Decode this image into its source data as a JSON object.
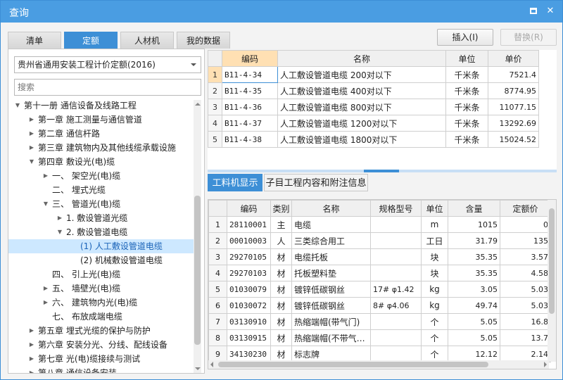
{
  "window": {
    "title": "查询"
  },
  "tabs": [
    {
      "label": "清单"
    },
    {
      "label": "定额"
    },
    {
      "label": "人材机"
    },
    {
      "label": "我的数据"
    }
  ],
  "active_tab": 1,
  "quota_select": {
    "value": "贵州省通用安装工程计价定额(2016)"
  },
  "search": {
    "placeholder": "搜索"
  },
  "tree": [
    {
      "label": "第十一册 通信设备及线路工程",
      "level": 0,
      "exp": "down"
    },
    {
      "label": "第一章 施工测量与通信管道",
      "level": 1,
      "exp": "right"
    },
    {
      "label": "第二章 通信杆路",
      "level": 1,
      "exp": "right"
    },
    {
      "label": "第三章 建筑物内及其他线缆承载设施",
      "level": 1,
      "exp": "right"
    },
    {
      "label": "第四章 敷设光(电)缆",
      "level": 1,
      "exp": "down"
    },
    {
      "label": "一、 架空光(电)缆",
      "level": 2,
      "exp": "right"
    },
    {
      "label": "二、 埋式光缆",
      "level": 2,
      "exp": ""
    },
    {
      "label": "三、 管道光(电)缆",
      "level": 2,
      "exp": "down"
    },
    {
      "label": "1. 敷设管道光缆",
      "level": 3,
      "exp": "right"
    },
    {
      "label": "2. 敷设管道电缆",
      "level": 3,
      "exp": "down"
    },
    {
      "label": "(1) 人工敷设管道电缆",
      "level": 4,
      "exp": "",
      "selected": true
    },
    {
      "label": "(2) 机械敷设管道电缆",
      "level": 4,
      "exp": ""
    },
    {
      "label": "四、 引上光(电)缆",
      "level": 2,
      "exp": ""
    },
    {
      "label": "五、 墙壁光(电)缆",
      "level": 2,
      "exp": "right"
    },
    {
      "label": "六、 建筑物内光(电)缆",
      "level": 2,
      "exp": "right"
    },
    {
      "label": "七、 布放成端电缆",
      "level": 2,
      "exp": ""
    },
    {
      "label": "第五章 埋式光缆的保护与防护",
      "level": 1,
      "exp": "right"
    },
    {
      "label": "第六章 安装分光、分线、配线设备",
      "level": 1,
      "exp": "right"
    },
    {
      "label": "第七章 光(电)缆接续与测试",
      "level": 1,
      "exp": "right"
    },
    {
      "label": "第八章 通信设备安装",
      "level": 1,
      "exp": "right"
    }
  ],
  "buttons": {
    "insert": "插入(I)",
    "replace": "替换(R)"
  },
  "top_table": {
    "headers": [
      "编码",
      "名称",
      "单位",
      "单价"
    ],
    "rows": [
      {
        "n": "1",
        "code": "B11-4-34",
        "name": "人工敷设管道电缆 200对以下",
        "unit": "千米条",
        "price": "7521.4"
      },
      {
        "n": "2",
        "code": "B11-4-35",
        "name": "人工敷设管道电缆 400对以下",
        "unit": "千米条",
        "price": "8774.95"
      },
      {
        "n": "3",
        "code": "B11-4-36",
        "name": "人工敷设管道电缆 800对以下",
        "unit": "千米条",
        "price": "11077.15"
      },
      {
        "n": "4",
        "code": "B11-4-37",
        "name": "人工敷设管道电缆 1200对以下",
        "unit": "千米条",
        "price": "13292.69"
      },
      {
        "n": "5",
        "code": "B11-4-38",
        "name": "人工敷设管道电缆 1800对以下",
        "unit": "千米条",
        "price": "15024.52"
      }
    ]
  },
  "bottom_tabs": [
    {
      "label": "工料机显示"
    },
    {
      "label": "子目工程内容和附注信息"
    }
  ],
  "bottom_table": {
    "headers": [
      "编码",
      "类别",
      "名称",
      "规格型号",
      "单位",
      "含量",
      "定额价"
    ],
    "rows": [
      {
        "n": "1",
        "code": "28110001",
        "type": "主",
        "name": "电缆",
        "spec": "",
        "unit": "m",
        "qty": "1015",
        "price": "0"
      },
      {
        "n": "2",
        "code": "00010003",
        "type": "人",
        "name": "三类综合用工",
        "spec": "",
        "unit": "工日",
        "qty": "31.79",
        "price": "135"
      },
      {
        "n": "3",
        "code": "29270105",
        "type": "材",
        "name": "电缆托板",
        "spec": "",
        "unit": "块",
        "qty": "35.35",
        "price": "3.57"
      },
      {
        "n": "4",
        "code": "29270103",
        "type": "材",
        "name": "托板塑料垫",
        "spec": "",
        "unit": "块",
        "qty": "35.35",
        "price": "4.58"
      },
      {
        "n": "5",
        "code": "01030079",
        "type": "材",
        "name": "镀锌低碳钢丝",
        "spec": "17# φ1.42",
        "unit": "kg",
        "qty": "3.05",
        "price": "5.03"
      },
      {
        "n": "6",
        "code": "01030072",
        "type": "材",
        "name": "镀锌低碳钢丝",
        "spec": "8# φ4.06",
        "unit": "kg",
        "qty": "49.74",
        "price": "5.03"
      },
      {
        "n": "7",
        "code": "03130910",
        "type": "材",
        "name": "热缩端帽(带气门)",
        "spec": "",
        "unit": "个",
        "qty": "5.05",
        "price": "16.8"
      },
      {
        "n": "8",
        "code": "03130915",
        "type": "材",
        "name": "热缩端帽(不带气…",
        "spec": "",
        "unit": "个",
        "qty": "5.05",
        "price": "13.7"
      },
      {
        "n": "9",
        "code": "34130230",
        "type": "材",
        "name": "标志牌",
        "spec": "",
        "unit": "个",
        "qty": "12.12",
        "price": "2.14"
      }
    ]
  }
}
